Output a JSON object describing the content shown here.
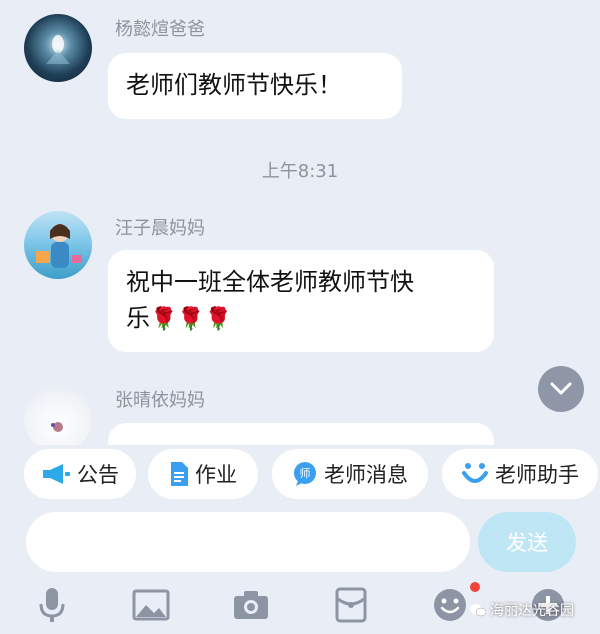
{
  "messages": [
    {
      "sender": "杨懿煊爸爸",
      "text": "老师们教师节快乐！"
    },
    {
      "sender": "汪子晨妈妈",
      "text_line1": "祝中一班全体老师教师节快",
      "text_line2": "乐",
      "emoji": "🌹🌹🌹"
    },
    {
      "sender": "张晴依妈妈"
    }
  ],
  "timestamp": "上午8:31",
  "quick_actions": [
    {
      "label": "公告",
      "icon": "megaphone-icon",
      "color": "#2da9e9"
    },
    {
      "label": "作业",
      "icon": "document-icon",
      "color": "#3a9ff0"
    },
    {
      "label": "老师消息",
      "icon": "teacher-chat-icon",
      "color": "#3a9ff0"
    },
    {
      "label": "老师助手",
      "icon": "assistant-icon",
      "color": "#3a9ff0"
    }
  ],
  "composer": {
    "placeholder": "",
    "send_label": "发送"
  },
  "toolbar": {
    "items": [
      "microphone-icon",
      "image-icon",
      "camera-icon",
      "red-packet-icon",
      "emoji-icon",
      "plus-icon"
    ],
    "badge_color": "#f2423a"
  },
  "watermark": "海丽达光谷园"
}
